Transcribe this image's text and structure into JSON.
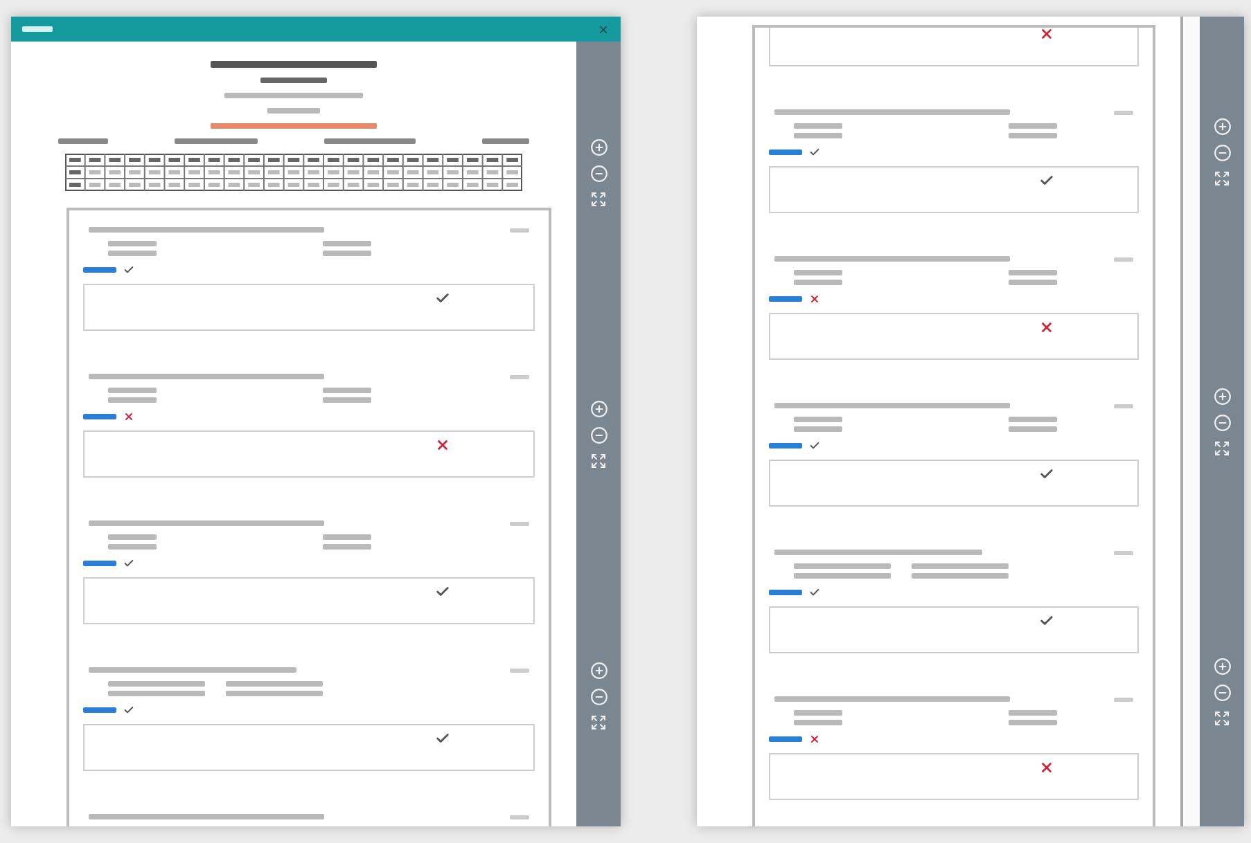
{
  "windows": [
    {
      "kind": "first-page",
      "questions": [
        {
          "kind": "two-column",
          "correct": true
        },
        {
          "kind": "two-column",
          "correct": false
        },
        {
          "kind": "two-column",
          "correct": true
        },
        {
          "kind": "four-wide",
          "correct": true
        },
        {
          "kind": "two-column"
        }
      ]
    },
    {
      "kind": "continued",
      "questions": [
        {
          "kind": "two-column",
          "correct": false
        },
        {
          "kind": "two-column",
          "correct": true
        },
        {
          "kind": "two-column",
          "correct": false
        },
        {
          "kind": "two-column",
          "correct": true
        },
        {
          "kind": "four-wide",
          "correct": true
        },
        {
          "kind": "two-column",
          "correct": false
        }
      ]
    }
  ]
}
